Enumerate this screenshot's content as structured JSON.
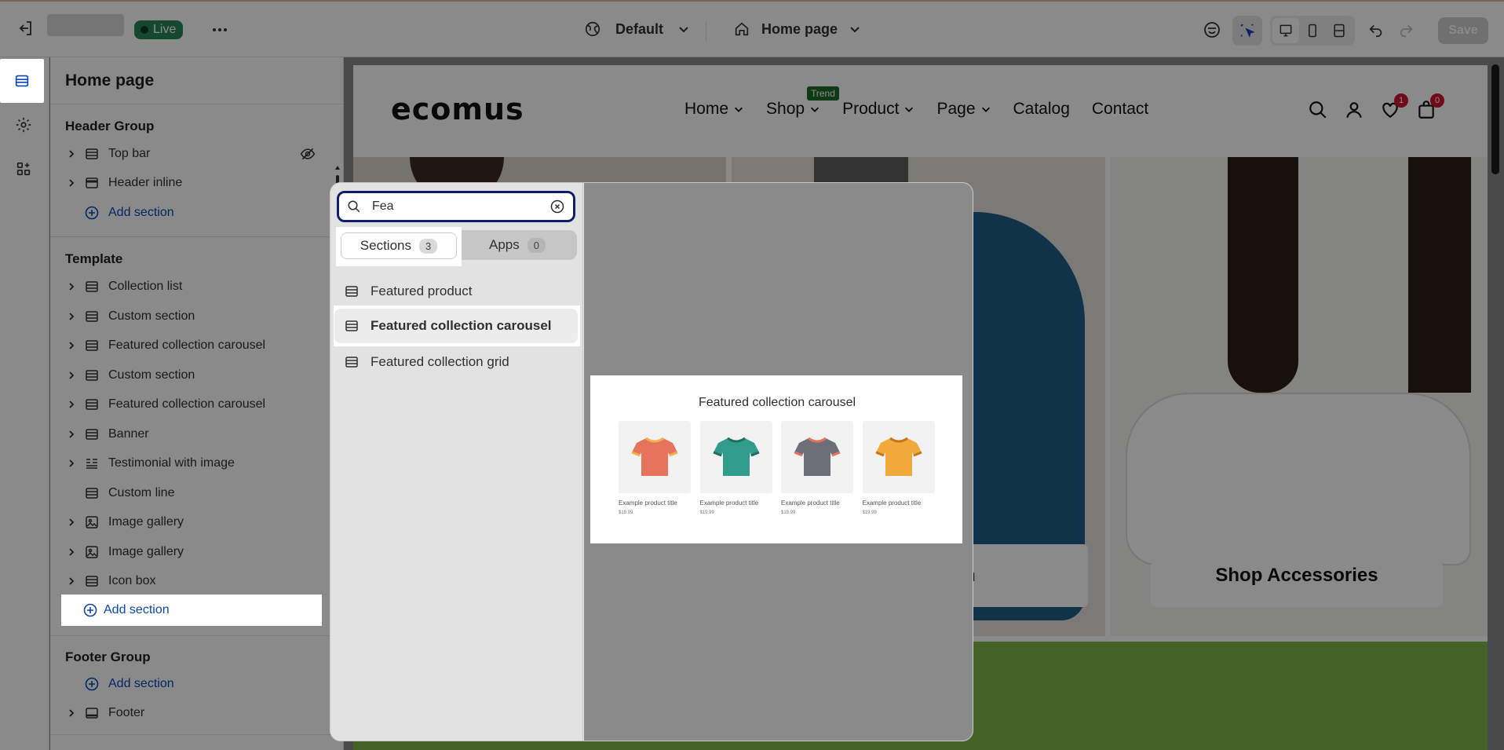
{
  "topbar": {
    "status": "Live",
    "theme": "Default",
    "page": "Home page",
    "save": "Save"
  },
  "sidebar": {
    "title": "Home page",
    "header_group": {
      "title": "Header Group",
      "items": [
        {
          "label": "Top bar"
        },
        {
          "label": "Header inline"
        }
      ],
      "add": "Add section"
    },
    "template": {
      "title": "Template",
      "items": [
        {
          "label": "Collection list"
        },
        {
          "label": "Custom section"
        },
        {
          "label": "Featured collection carousel"
        },
        {
          "label": "Custom section"
        },
        {
          "label": "Featured collection carousel"
        },
        {
          "label": "Banner"
        },
        {
          "label": "Testimonial with image"
        },
        {
          "label": "Custom line"
        },
        {
          "label": "Image gallery"
        },
        {
          "label": "Image gallery"
        },
        {
          "label": "Icon box"
        }
      ],
      "add": "Add section"
    },
    "footer_group": {
      "title": "Footer Group",
      "add": "Add section",
      "items": [
        {
          "label": "Footer"
        }
      ]
    }
  },
  "store": {
    "logo": "ecomus",
    "nav": [
      "Home",
      "Shop",
      "Product",
      "Page",
      "Catalog",
      "Contact"
    ],
    "trend_badge": "Trend",
    "wishlist_count": "1",
    "cart_count": "0",
    "banner_button_partial": "n",
    "banner_button": "Shop Accessories",
    "accent_green": "#7ab648"
  },
  "modal": {
    "search_value": "Fea",
    "tabs": [
      {
        "label": "Sections",
        "count": "3"
      },
      {
        "label": "Apps",
        "count": "0"
      }
    ],
    "results": [
      {
        "label": "Featured product"
      },
      {
        "label": "Featured collection carousel"
      },
      {
        "label": "Featured collection grid"
      }
    ],
    "preview": {
      "title": "Featured collection carousel",
      "products": [
        {
          "title": "Example product title",
          "price": "$19.99",
          "color": "#e8735c",
          "trim": "#f0b24c"
        },
        {
          "title": "Example product title",
          "price": "$19.99",
          "color": "#2f9c8c",
          "trim": "#1f6d63"
        },
        {
          "title": "Example product title",
          "price": "$19.99",
          "color": "#6d6f78",
          "trim": "#e8735c"
        },
        {
          "title": "Example product title",
          "price": "$19.99",
          "color": "#f0a93a",
          "trim": "#c7741c"
        }
      ]
    }
  }
}
